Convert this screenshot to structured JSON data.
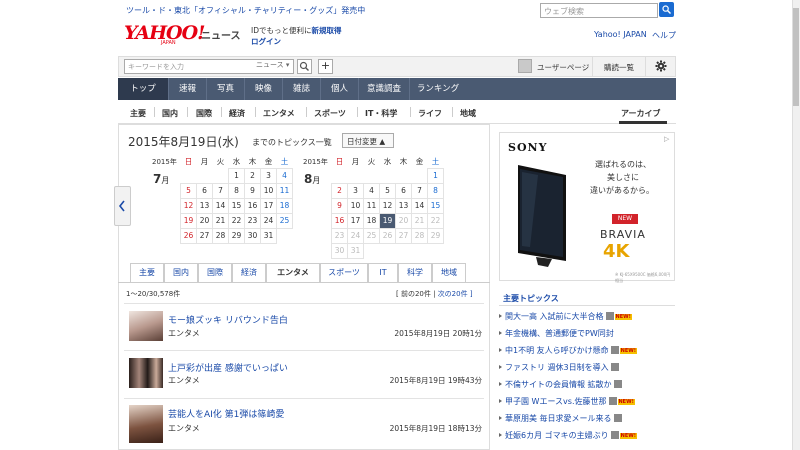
{
  "header": {
    "promo": "ツール・ド・東北「オフィシャル・チャリティー・グッズ」発売中",
    "search_placeholder": "ウェブ検索",
    "logo_text": "YAHOO!",
    "logo_sub": "JAPAN",
    "news_word": "ニュース",
    "login_note_prefix": "IDでもっと便利に",
    "login_note_link": "新規取得",
    "login_link": "ログイン",
    "yahoo_japan_link": "Yahoo! JAPAN",
    "help_link": "ヘルプ"
  },
  "toolbar": {
    "keyword_placeholder": "キーワードを入力",
    "keyword_category": "ニュース ▾",
    "plus": "+",
    "user_page": "ユーザーページ",
    "list_button": "購読一覧"
  },
  "main_nav": [
    "トップ",
    "速報",
    "写真",
    "映像",
    "雑誌",
    "個人",
    "意識調査",
    "ランキング"
  ],
  "sub_nav": [
    "主要",
    "国内",
    "国際",
    "経済",
    "エンタメ",
    "スポーツ",
    "IT・科学",
    "ライフ",
    "地域"
  ],
  "archive": "アーカイブ",
  "date": {
    "title": "2015年8月19日(水)",
    "suffix": "までのトピックス一覧",
    "change_button": "日付変更 ▲"
  },
  "calendars": [
    {
      "year": "2015年",
      "month": "7",
      "month_unit": "月",
      "weekdays": [
        "日",
        "月",
        "火",
        "水",
        "木",
        "金",
        "土"
      ],
      "weeks": [
        [
          "",
          "",
          "",
          "1",
          "2",
          "3",
          "4"
        ],
        [
          "5",
          "6",
          "7",
          "8",
          "9",
          "10",
          "11"
        ],
        [
          "12",
          "13",
          "14",
          "15",
          "16",
          "17",
          "18"
        ],
        [
          "19",
          "20",
          "21",
          "22",
          "23",
          "24",
          "25"
        ],
        [
          "26",
          "27",
          "28",
          "29",
          "30",
          "31",
          ""
        ]
      ]
    },
    {
      "year": "2015年",
      "month": "8",
      "month_unit": "月",
      "weekdays": [
        "日",
        "月",
        "火",
        "水",
        "木",
        "金",
        "土"
      ],
      "weeks": [
        [
          "",
          "",
          "",
          "",
          "",
          "",
          "1"
        ],
        [
          "2",
          "3",
          "4",
          "5",
          "6",
          "7",
          "8"
        ],
        [
          "9",
          "10",
          "11",
          "12",
          "13",
          "14",
          "15"
        ],
        [
          "16",
          "17",
          "18",
          "19",
          "20",
          "21",
          "22"
        ],
        [
          "23",
          "24",
          "25",
          "26",
          "27",
          "28",
          "29"
        ],
        [
          "30",
          "31",
          "",
          "",
          "",
          "",
          ""
        ]
      ],
      "selected": "19"
    }
  ],
  "category_tabs": [
    "主要",
    "国内",
    "国際",
    "経済",
    "エンタメ",
    "スポーツ",
    "IT",
    "科学",
    "地域"
  ],
  "active_tab": "エンタメ",
  "list": {
    "count": "1〜20/30,578件",
    "pager_prev": "[ 前の20件",
    "pager_sep": " | ",
    "pager_next": "次の20件 ]",
    "items": [
      {
        "title": "モー娘ズッキ リバウンド告白",
        "category": "エンタメ",
        "time": "2015年8月19日 20時1分"
      },
      {
        "title": "上戸彩が出産 感謝でいっぱい",
        "category": "エンタメ",
        "time": "2015年8月19日 19時43分"
      },
      {
        "title": "芸能人をAI化 第1弾は篠崎愛",
        "category": "エンタメ",
        "time": "2015年8月19日 18時13分"
      }
    ]
  },
  "ad": {
    "brand": "SONY",
    "copy1": "選ばれるのは、",
    "copy2": "美しさに",
    "copy3": "違いがあるから。",
    "new_badge": "NEW",
    "product": "BRAVIA",
    "fourk": "4K",
    "fine_print": "※ KJ-65X9500C 価格6,000円相当"
  },
  "topics": {
    "title": "主要トピックス",
    "items": [
      {
        "text": "関大一高 入試前に大半合格",
        "icon": "camera-icon",
        "new": "NEW!"
      },
      {
        "text": "年金機構、普通郵便でPW同封",
        "icon": "",
        "new": ""
      },
      {
        "text": "中1不明 友人ら呼びかけ懸命",
        "icon": "camera-icon",
        "new": "NEW!"
      },
      {
        "text": "ファストリ 週休3日制を導入",
        "icon": "camera-icon",
        "new": ""
      },
      {
        "text": "不倫サイトの会員情報 拡散か",
        "icon": "camera-icon",
        "new": ""
      },
      {
        "text": "甲子園 Wエースvs.佐藤世那",
        "icon": "camera-icon",
        "new": "NEW!"
      },
      {
        "text": "華原朋美 毎日求愛メール来る",
        "icon": "camera-icon",
        "new": ""
      },
      {
        "text": "妊娠6カ月 ゴマキの主婦ぶり",
        "icon": "camera-icon",
        "new": "NEW!"
      }
    ]
  },
  "colors": {
    "nav_bg": "#4a5a72",
    "logo_red": "#e60012",
    "link_blue": "#1a4aa8",
    "sunday_red": "#d2232a",
    "saturday_blue": "#1a6bd1"
  }
}
